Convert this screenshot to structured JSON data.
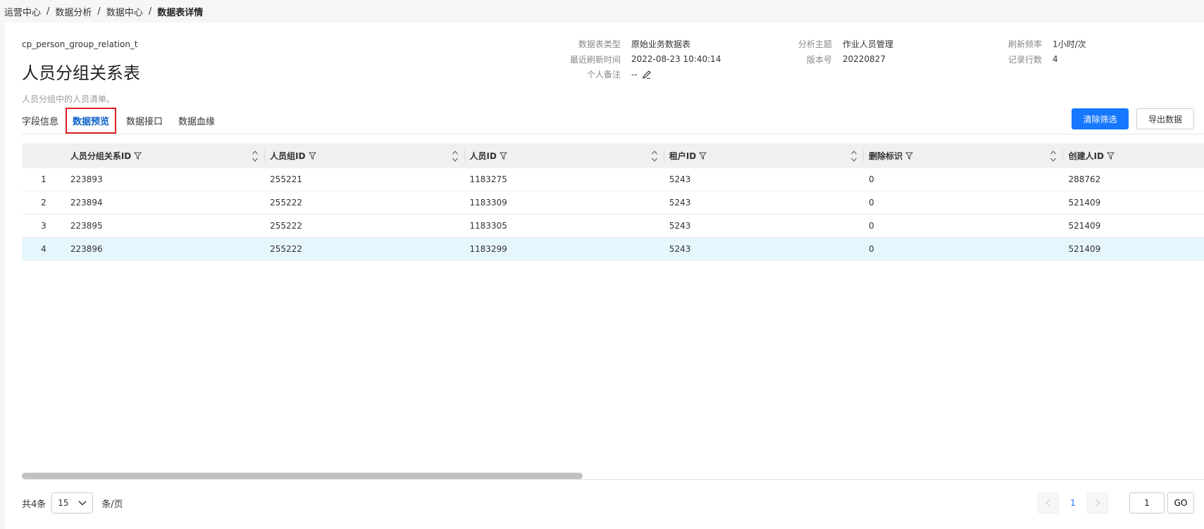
{
  "breadcrumb": [
    "运营中心",
    "数据分析",
    "数据中心",
    "数据表详情"
  ],
  "table": {
    "code": "cp_person_group_relation_t",
    "title": "人员分组关系表",
    "desc": "人员分组中的人员清单。"
  },
  "meta": {
    "type_label": "数据表类型",
    "type_value": "原始业务数据表",
    "refresh_label": "最近刷新时间",
    "refresh_value": "2022-08-23 10:40:14",
    "note_label": "个人备注",
    "note_value": "--",
    "topic_label": "分析主题",
    "topic_value": "作业人员管理",
    "version_label": "版本号",
    "version_value": "20220827",
    "freq_label": "刷新频率",
    "freq_value": "1小时/次",
    "rows_label": "记录行数",
    "rows_value": "4"
  },
  "tabs": [
    "字段信息",
    "数据预览",
    "数据接口",
    "数据血缘"
  ],
  "actions": {
    "clear": "清除筛选",
    "export": "导出数据"
  },
  "grid": {
    "columns": [
      "人员分组关系ID",
      "人员组ID",
      "人员ID",
      "租户ID",
      "删除标识",
      "创建人ID"
    ],
    "rows": [
      [
        "1",
        "223893",
        "255221",
        "1183275",
        "5243",
        "0",
        "288762"
      ],
      [
        "2",
        "223894",
        "255222",
        "1183309",
        "5243",
        "0",
        "521409"
      ],
      [
        "3",
        "223895",
        "255222",
        "1183305",
        "5243",
        "0",
        "521409"
      ],
      [
        "4",
        "223896",
        "255222",
        "1183299",
        "5243",
        "0",
        "521409"
      ]
    ]
  },
  "pager": {
    "total": "共4条",
    "page_size": "15",
    "per_page": "条/页",
    "current": "1",
    "jump_value": "1",
    "go": "GO"
  }
}
